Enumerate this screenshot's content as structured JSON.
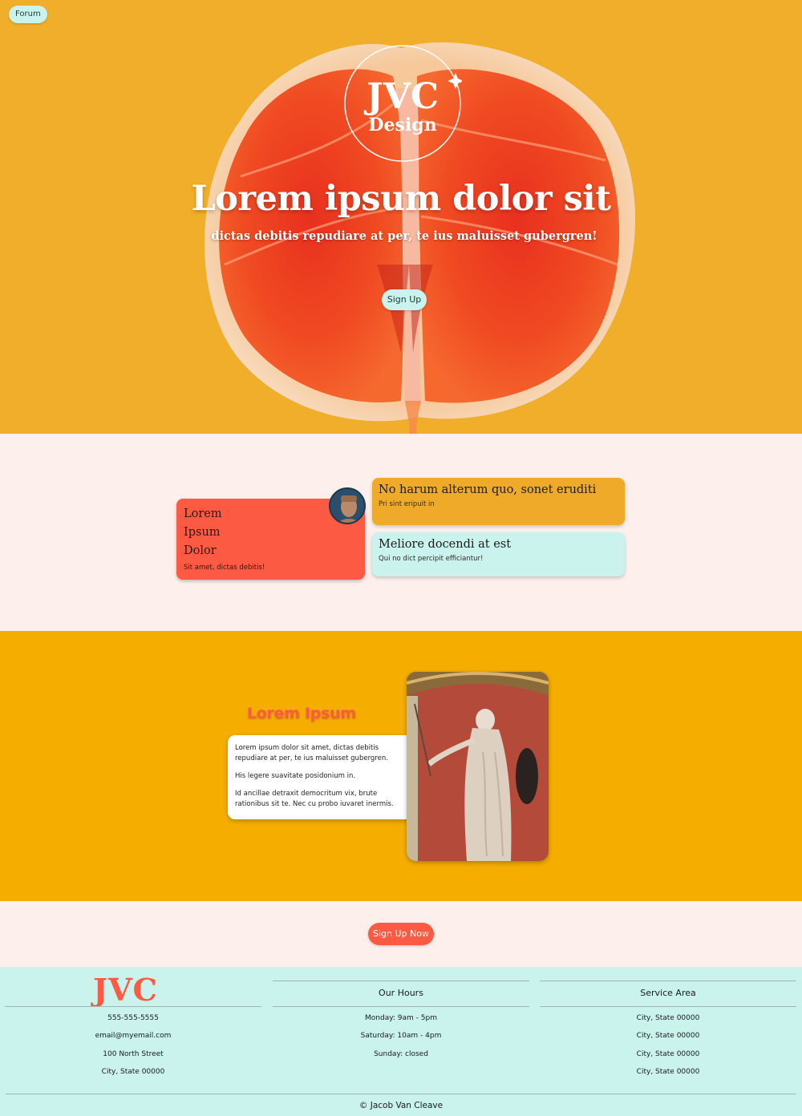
{
  "nav": {
    "forum_label": "Forum"
  },
  "hero": {
    "logo_top": "JVC",
    "logo_bottom": "Design",
    "title": "Lorem ipsum dolor sit",
    "subtitle": "dictas debitis repudiare at per, te ius maluisset gubergren!",
    "signup_label": "Sign Up"
  },
  "cards": {
    "red": {
      "line1": "Lorem",
      "line2": "Ipsum",
      "line3": "Dolor",
      "sub": "Sit amet, dictas debitis!"
    },
    "yellow": {
      "title": "No harum alterum quo, sonet eruditi",
      "sub": "Pri sint eripuit in"
    },
    "cyan": {
      "title": "Meliore docendi at est",
      "sub": "Qui no dict percipit efficiantur!"
    }
  },
  "feature": {
    "title": "Lorem Ipsum",
    "paragraphs": [
      "Lorem ipsum dolor sit amet, dictas debitis repudiare at per, te ius maluisset gubergren.",
      "His legere suavitate posidonium in.",
      "Id ancillae detraxit democritum vix, brute rationibus sit te. Nec cu probo iuvaret inermis."
    ]
  },
  "cta": {
    "label": "Sign Up Now"
  },
  "footer": {
    "logo": "JVC",
    "contact": [
      "555-555-5555",
      "email@myemail.com",
      "100 North Street",
      "City, State 00000"
    ],
    "hours": {
      "heading": "Our Hours",
      "lines": [
        "Monday: 9am - 5pm",
        "Saturday: 10am - 4pm",
        "Sunday: closed"
      ]
    },
    "service": {
      "heading": "Service Area",
      "lines": [
        "City, State 00000",
        "City, State 00000",
        "City, State 00000",
        "City, State 00000"
      ]
    },
    "copyright": "© Jacob Van Cleave"
  },
  "colors": {
    "hero_bg": "#f1ae2a",
    "coral": "#fd5a44",
    "mint": "#c9f3ec",
    "gold": "#f5ae00",
    "blush": "#fdf0ec"
  }
}
